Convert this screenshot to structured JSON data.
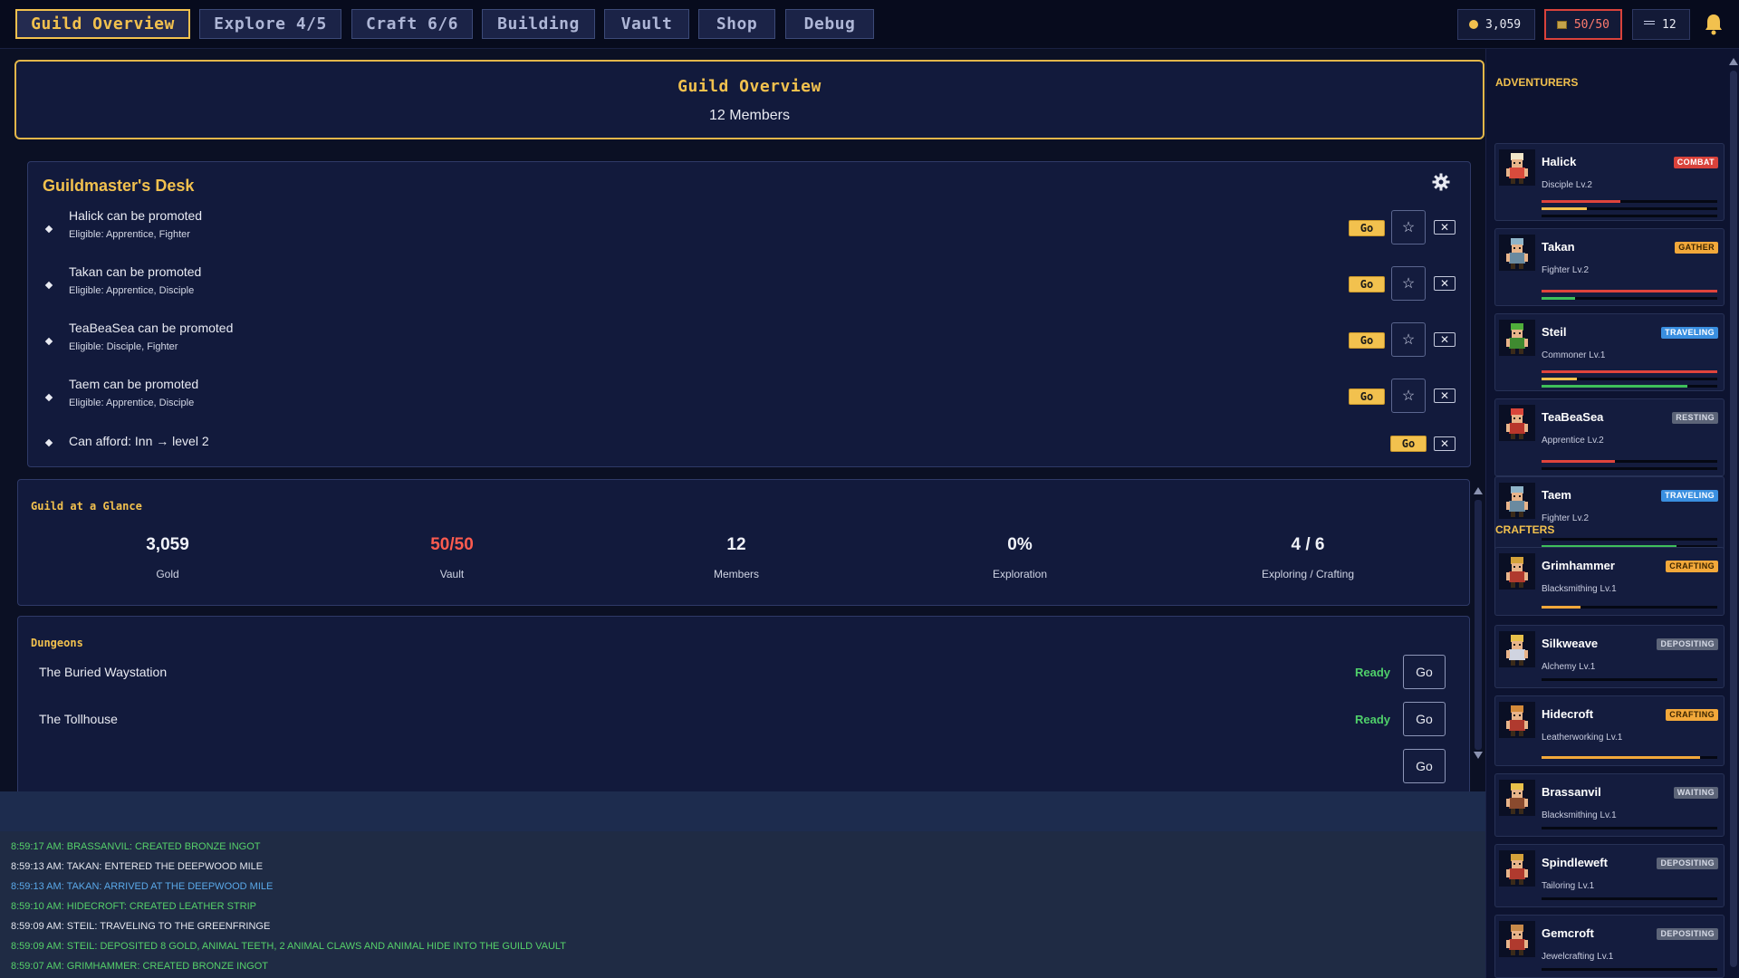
{
  "nav": {
    "tabs": [
      {
        "label": "Guild Overview",
        "active": true
      },
      {
        "label": "Explore 4/5",
        "active": false
      },
      {
        "label": "Craft 6/6",
        "active": false
      },
      {
        "label": "Building",
        "active": false
      },
      {
        "label": "Vault",
        "active": false
      },
      {
        "label": "Shop",
        "active": false
      },
      {
        "label": "Debug",
        "active": false
      }
    ],
    "stats": {
      "gold": "3,059",
      "vault": "50/50",
      "members": "12"
    },
    "icons": [
      "coin-icon",
      "vault-icon",
      "members-icon",
      "bell-icon"
    ]
  },
  "header": {
    "title": "Guild Overview",
    "subtitle": "12 Members"
  },
  "desk": {
    "title": "Guildmaster's Desk",
    "go_label": "Go",
    "star_glyph": "☆",
    "close_glyph": "✕",
    "items": [
      {
        "title": "Halick can be promoted",
        "subtitle": "Eligible: Apprentice, Fighter"
      },
      {
        "title": "Takan can be promoted",
        "subtitle": "Eligible: Apprentice, Disciple"
      },
      {
        "title": "TeaBeaSea can be promoted",
        "subtitle": "Eligible: Disciple, Fighter"
      },
      {
        "title": "Taem can be promoted",
        "subtitle": "Eligible: Apprentice, Disciple"
      }
    ],
    "afford": {
      "title": "Can afford: Inn → level 2"
    }
  },
  "glance": {
    "title": "Guild at a Glance",
    "stats": [
      {
        "value": "3,059",
        "label": "Gold",
        "color": "#f0f2f8"
      },
      {
        "value": "50/50",
        "label": "Vault",
        "color": "#ff5b4f"
      },
      {
        "value": "12",
        "label": "Members",
        "color": "#f0f2f8"
      },
      {
        "value": "0%",
        "label": "Exploration",
        "color": "#f0f2f8"
      },
      {
        "value": "4 / 6",
        "label": "Exploring / Crafting",
        "color": "#f0f2f8"
      }
    ]
  },
  "dungeons": {
    "title": "Dungeons",
    "go_label": "Go",
    "items": [
      {
        "name": "The Buried Waystation",
        "status": "Ready"
      },
      {
        "name": "The Tollhouse",
        "status": "Ready"
      }
    ]
  },
  "log": [
    {
      "text": "8:59:17 AM: BRASSANVIL: CREATED BRONZE INGOT",
      "color": "#56d16a"
    },
    {
      "text": "8:59:13 AM: TAKAN: ENTERED THE DEEPWOOD MILE",
      "color": "#e4e6ee"
    },
    {
      "text": "8:59:13 AM: TAKAN: ARRIVED AT THE DEEPWOOD MILE",
      "color": "#5aa8e8"
    },
    {
      "text": "8:59:10 AM: HIDECROFT: CREATED LEATHER STRIP",
      "color": "#56d16a"
    },
    {
      "text": "8:59:09 AM: STEIL: TRAVELING TO THE GREENFRINGE",
      "color": "#e4e6ee"
    },
    {
      "text": "8:59:09 AM: STEIL: DEPOSITED 8 GOLD, ANIMAL TEETH, 2 ANIMAL CLAWS AND ANIMAL HIDE INTO THE GUILD VAULT",
      "color": "#56d16a"
    },
    {
      "text": "8:59:07 AM: GRIMHAMMER: CREATED BRONZE INGOT",
      "color": "#56d16a"
    }
  ],
  "sidebar": {
    "adventurers_heading": "ADVENTURERS",
    "crafters_heading": "CRAFTERS",
    "adventurers": [
      {
        "name": "Halick",
        "class": "Disciple Lv.2",
        "status": "COMBAT",
        "status_bg": "#d9423b",
        "status_fg": "#ffffff",
        "hair": "#f0e6c8",
        "body": "#d94b3c",
        "bars": [
          {
            "fill": 0.45,
            "color": "#e0443c"
          },
          {
            "fill": 0.26,
            "color": "#f2c14e"
          },
          {
            "fill": 0.0,
            "color": "#3fbf5a"
          }
        ]
      },
      {
        "name": "Takan",
        "class": "Fighter Lv.2",
        "status": "GATHER",
        "status_bg": "#f2a83a",
        "status_fg": "#3a2400",
        "hair": "#8fb4c8",
        "body": "#6a8aa0",
        "bars": [
          {
            "fill": 1.0,
            "color": "#e0443c"
          },
          {
            "fill": 0.19,
            "color": "#3fbf5a"
          }
        ]
      },
      {
        "name": "Steil",
        "class": "Commoner Lv.1",
        "status": "TRAVELING",
        "status_bg": "#3a8fe0",
        "status_fg": "#ffffff",
        "hair": "#4fae3a",
        "body": "#3f8a30",
        "bars": [
          {
            "fill": 1.0,
            "color": "#e0443c"
          },
          {
            "fill": 0.2,
            "color": "#f2c14e"
          },
          {
            "fill": 0.83,
            "color": "#3fbf5a"
          }
        ]
      },
      {
        "name": "TeaBeaSea",
        "class": "Apprentice Lv.2",
        "status": "RESTING",
        "status_bg": "#5c6478",
        "status_fg": "#d6dae6",
        "hair": "#d9453a",
        "body": "#b8362c",
        "bars": [
          {
            "fill": 0.42,
            "color": "#e0443c"
          },
          {
            "fill": 0.0,
            "color": "#3fbf5a"
          }
        ]
      },
      {
        "name": "Taem",
        "class": "Fighter Lv.2",
        "status": "TRAVELING",
        "status_bg": "#3a8fe0",
        "status_fg": "#ffffff",
        "hair": "#8fb4c8",
        "body": "#6a8aa0",
        "bars": [
          {
            "fill": 0.0,
            "color": "#e0443c"
          },
          {
            "fill": 0.77,
            "color": "#3fbf5a"
          }
        ]
      }
    ],
    "crafters": [
      {
        "name": "Grimhammer",
        "class": "Blacksmithing Lv.1",
        "status": "CRAFTING",
        "status_bg": "#f2a83a",
        "status_fg": "#3a2400",
        "hair": "#d4a23a",
        "body": "#b03a2e",
        "bar": {
          "fill": 0.22,
          "color": "#f2a83a"
        }
      },
      {
        "name": "Silkweave",
        "class": "Alchemy Lv.1",
        "status": "DEPOSITING",
        "status_bg": "#5c6478",
        "status_fg": "#d6dae6",
        "hair": "#e8c14a",
        "body": "#d0d4e0",
        "bar": {
          "fill": 0.0,
          "color": "#f2a83a"
        }
      },
      {
        "name": "Hidecroft",
        "class": "Leatherworking Lv.1",
        "status": "CRAFTING",
        "status_bg": "#f2a83a",
        "status_fg": "#3a2400",
        "hair": "#d48a3a",
        "body": "#b03a2e",
        "bar": {
          "fill": 0.9,
          "color": "#f2a83a"
        }
      },
      {
        "name": "Brassanvil",
        "class": "Blacksmithing Lv.1",
        "status": "WAITING",
        "status_bg": "#5c6478",
        "status_fg": "#d6dae6",
        "hair": "#e8c14a",
        "body": "#8a4a2e",
        "bar": {
          "fill": 0.0,
          "color": "#f2a83a"
        }
      },
      {
        "name": "Spindleweft",
        "class": "Tailoring Lv.1",
        "status": "DEPOSITING",
        "status_bg": "#5c6478",
        "status_fg": "#d6dae6",
        "hair": "#d4a23a",
        "body": "#b03a2e",
        "bar": {
          "fill": 0.0,
          "color": "#f2a83a"
        }
      },
      {
        "name": "Gemcroft",
        "class": "Jewelcrafting Lv.1",
        "status": "DEPOSITING",
        "status_bg": "#5c6478",
        "status_fg": "#d6dae6",
        "hair": "#c88a4a",
        "body": "#b03a2e",
        "bar": {
          "fill": 0.0,
          "color": "#f2a83a"
        }
      }
    ]
  }
}
